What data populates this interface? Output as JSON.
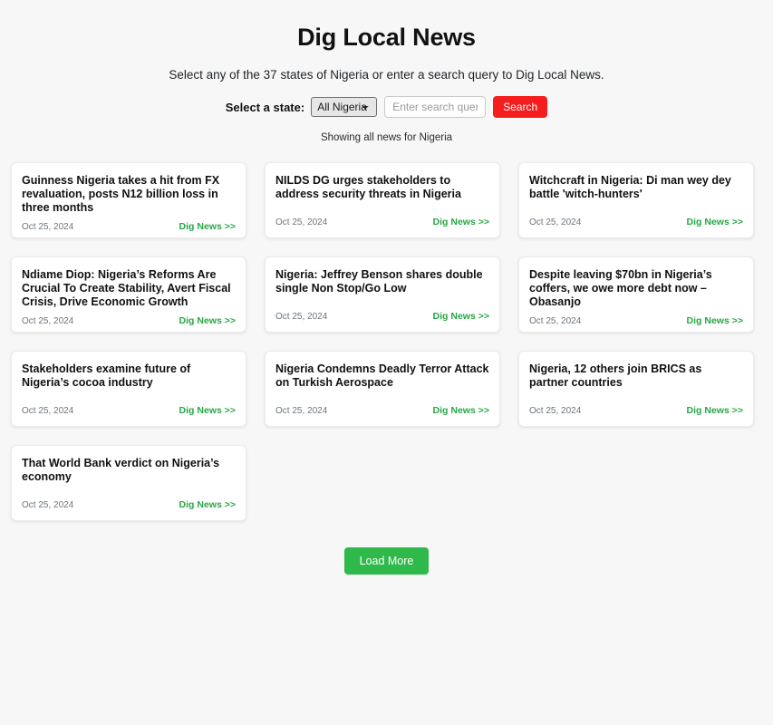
{
  "header": {
    "title": "Dig Local News",
    "subtitle": "Select any of the 37 states of Nigeria or enter a search query to Dig Local News."
  },
  "search": {
    "label": "Select a state:",
    "selected_state": "All Nigeria",
    "state_options": [
      "All Nigeria"
    ],
    "placeholder": "Enter search query",
    "value": "",
    "button_label": "Search",
    "dropdown_icon": "chevron-down-icon"
  },
  "status": {
    "showing_text": "Showing all news for Nigeria"
  },
  "cards": [
    {
      "title": "Guinness Nigeria takes a hit from FX revaluation, posts N12 billion loss in three months",
      "date": "Oct 25, 2024",
      "link": "Dig News >>",
      "size": "h-tall"
    },
    {
      "title": "NILDS DG urges stakeholders to address security threats in Nigeria",
      "date": "Oct 25, 2024",
      "link": "Dig News >>",
      "size": "h-mid"
    },
    {
      "title": "Witchcraft in Nigeria: Di man wey dey battle 'witch-hunters'",
      "date": "Oct 25, 2024",
      "link": "Dig News >>",
      "size": "h-mid"
    },
    {
      "title": "Ndiame Diop: Nigeria’s Reforms Are Crucial To Create Stability, Avert Fiscal Crisis, Drive Economic Growth",
      "date": "Oct 25, 2024",
      "link": "Dig News >>",
      "size": "h-tall"
    },
    {
      "title": "Nigeria: Jeffrey Benson shares double single Non Stop/Go Low",
      "date": "Oct 25, 2024",
      "link": "Dig News >>",
      "size": "h-mid"
    },
    {
      "title": "Despite leaving $70bn in Nigeria’s coffers, we owe more debt now – Obasanjo",
      "date": "Oct 25, 2024",
      "link": "Dig News >>",
      "size": "h-mid"
    },
    {
      "title": "Stakeholders examine future of Nigeria’s cocoa industry",
      "date": "Oct 25, 2024",
      "link": "Dig News >>",
      "size": "h-mid"
    },
    {
      "title": "Nigeria Condemns Deadly Terror Attack on Turkish Aerospace",
      "date": "Oct 25, 2024",
      "link": "Dig News >>",
      "size": "h-mid"
    },
    {
      "title": "Nigeria, 12 others join BRICS as partner countries",
      "date": "Oct 25, 2024",
      "link": "Dig News >>",
      "size": "h-mid"
    },
    {
      "title": "That World Bank verdict on Nigeria’s economy",
      "date": "Oct 25, 2024",
      "link": "Dig News >>",
      "size": "h-mid"
    }
  ],
  "footer": {
    "load_more_label": "Load More"
  },
  "colors": {
    "search_button": "#f51d1d",
    "load_more_button": "#2fb94a",
    "link_green": "#28a745",
    "page_background": "#f7f7f7"
  }
}
